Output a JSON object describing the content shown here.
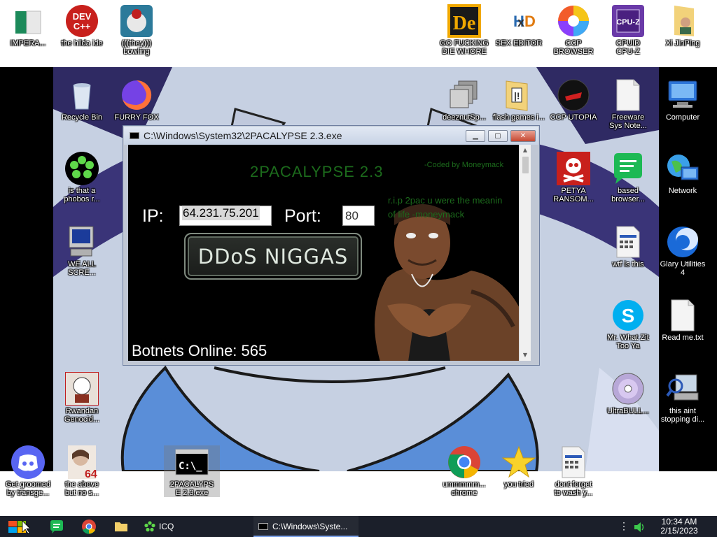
{
  "desktop": {
    "top_icons": [
      {
        "name": "imperia",
        "label": "IMPERA..."
      },
      {
        "name": "devcpp",
        "label": "the hilda ide",
        "icon_text": "DEV\nC++"
      },
      {
        "name": "bowling",
        "label": "(((they)))\nbowling"
      },
      {
        "name": "de",
        "label": "GO FUCKING\nDIE WHORE",
        "icon_text": "De"
      },
      {
        "name": "hxd",
        "label": "SEX EDITOR",
        "icon_text": "HxD"
      },
      {
        "name": "ccp-browser",
        "label": "CCP\nBROWSER"
      },
      {
        "name": "cpuz",
        "label": "CPUID\nCPU-Z",
        "icon_text": "CPU-Z"
      },
      {
        "name": "xijinping",
        "label": "Xi JinPing"
      }
    ],
    "left_icons": [
      {
        "name": "recycle-bin",
        "label": "Recycle Bin"
      },
      {
        "name": "furry-fox",
        "label": "FURRY FOX"
      },
      {
        "name": "phobos",
        "label": "is that a\nphobos r..."
      },
      {
        "name": "we-all-scream",
        "label": "WE ALL\nSCRE..."
      },
      {
        "name": "rwandan",
        "label": "Rwandan\nGenocid..."
      },
      {
        "name": "get-groomed",
        "label": "Get groomed\nby transge..."
      },
      {
        "name": "the-above",
        "label": "the above\nbut no s..."
      },
      {
        "name": "2pacalypse-exe",
        "label": "2PACALYPS\nE 2.3.exe",
        "icon_text": "C:\\_"
      }
    ],
    "right_icons": [
      {
        "name": "deeznut",
        "label": "deeznutSp..."
      },
      {
        "name": "flash-games",
        "label": "flash games i..."
      },
      {
        "name": "ccp-utopia",
        "label": "CCP UTOPIA"
      },
      {
        "name": "freeware",
        "label": "Freeware\nSys Note..."
      },
      {
        "name": "computer",
        "label": "Computer"
      },
      {
        "name": "petya",
        "label": "PETYA\nRANSOM..."
      },
      {
        "name": "based-browser",
        "label": "based\nbrowser..."
      },
      {
        "name": "network",
        "label": "Network"
      },
      {
        "name": "wtf-is-this",
        "label": "wtf is this"
      },
      {
        "name": "glary",
        "label": "Glary Utilities\n4"
      },
      {
        "name": "skype",
        "label": "Mr. What Zit\nToo Ya"
      },
      {
        "name": "readme",
        "label": "Read me.txt"
      },
      {
        "name": "ultrabull",
        "label": "UltraBULL..."
      },
      {
        "name": "this-aint",
        "label": "this aint\nstopping di..."
      },
      {
        "name": "chrome",
        "label": "ummmmm...\nchrome"
      },
      {
        "name": "you-tried",
        "label": "you tried"
      },
      {
        "name": "dont-forget",
        "label": "dont forget\nto wash y..."
      }
    ]
  },
  "window": {
    "title": "C:\\Windows\\System32\\2PACALYPSE 2.3.exe",
    "app_name": "2PACALYPSE  2.3",
    "coded_by": "-Coded by Moneymack",
    "rip_line1": "r.i.p 2pac u were the meanin",
    "rip_line2": "of life -moneymack",
    "ip_label": "IP:",
    "ip_value": "64.231.75.201",
    "port_label": "Port:",
    "port_value": "80",
    "button_label": "DDoS NIGGAS",
    "botnets": "Botnets Online: 565"
  },
  "taskbar": {
    "icq_label": "ICQ",
    "task_label": "C:\\Windows\\Syste...",
    "time": "10:34 AM",
    "date": "2/15/2023"
  },
  "colors": {
    "app_green": "#1c6b1c",
    "taskbar_bg": "#1b1f2a"
  }
}
